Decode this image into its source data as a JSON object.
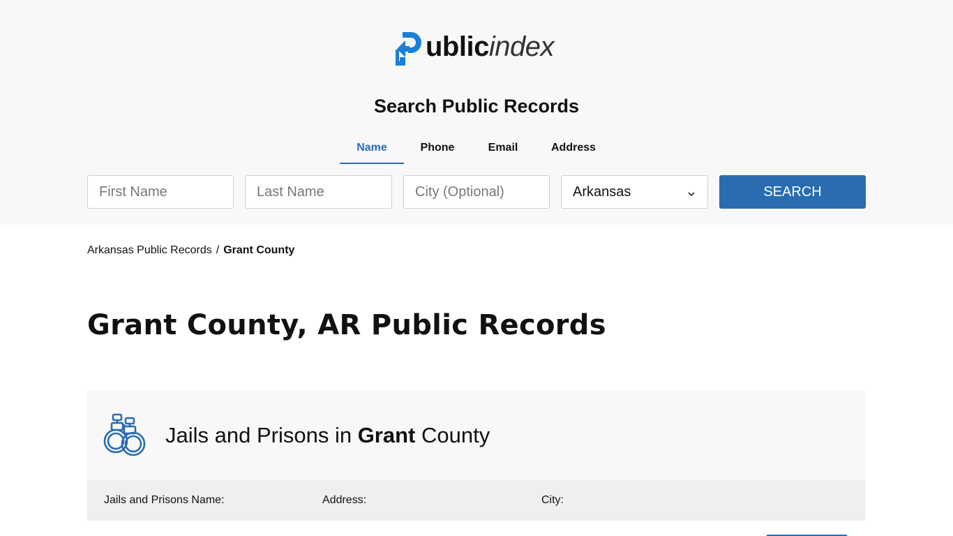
{
  "logo": {
    "public": "ublic",
    "index": "index"
  },
  "search": {
    "title": "Search Public Records",
    "tabs": [
      {
        "label": "Name",
        "active": true
      },
      {
        "label": "Phone",
        "active": false
      },
      {
        "label": "Email",
        "active": false
      },
      {
        "label": "Address",
        "active": false
      }
    ],
    "first_name_placeholder": "First Name",
    "last_name_placeholder": "Last Name",
    "city_placeholder": "City (Optional)",
    "state_value": "Arkansas",
    "button_label": "SEARCH"
  },
  "breadcrumb": {
    "parent": "Arkansas Public Records",
    "separator": "/",
    "current": "Grant County"
  },
  "page_title": "Grant County, AR Public Records",
  "section": {
    "title_prefix": "Jails and Prisons in ",
    "title_bold": "Grant",
    "title_suffix": " County",
    "icon": "handcuffs-icon",
    "columns": {
      "name": "Jails and Prisons Name:",
      "address": "Address:",
      "city": "City:"
    }
  },
  "colors": {
    "accent": "#2a6cb0",
    "header_bg": "#f8f8f8",
    "table_head_bg": "#efefef"
  }
}
